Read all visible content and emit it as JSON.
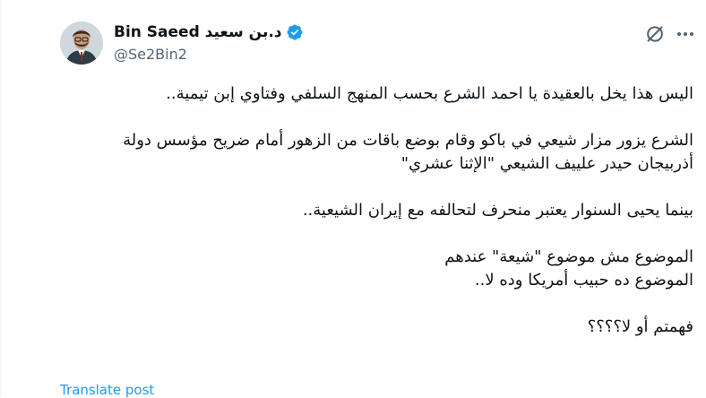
{
  "author": {
    "display_name": "د.بن سعيد Bin Saeed",
    "handle": "@Se2Bin2",
    "verified": true
  },
  "tweet": {
    "paragraphs": [
      "اليس هذا يخل بالعقيدة يا احمد الشرع بحسب المنهج السلفي وفتاوي إبن تيمية..",
      "الشرع يزور مزار شيعي في باكو وقام بوضع باقات من الزهور أمام ضريح مؤسس دولة أذربيجان حيدر علييف الشيعي \"الإثنا عشري\"",
      "بينما يحيى السنوار يعتبر منحرف لتحالفه مع إيران الشيعية..",
      "الموضوع مش موضوع \"شيعة\" عندهم\nالموضوع ده حبيب أمريكا وده لا..",
      "فهمتم أو لا؟؟؟؟"
    ]
  },
  "actions": {
    "translate_label": "Translate post"
  },
  "icons": {
    "verified": "verified-badge-icon",
    "grok": "grok-icon",
    "more": "more-options-icon"
  },
  "colors": {
    "accent": "#1d9bf0",
    "text_primary": "#0f1419",
    "text_secondary": "#536471"
  }
}
